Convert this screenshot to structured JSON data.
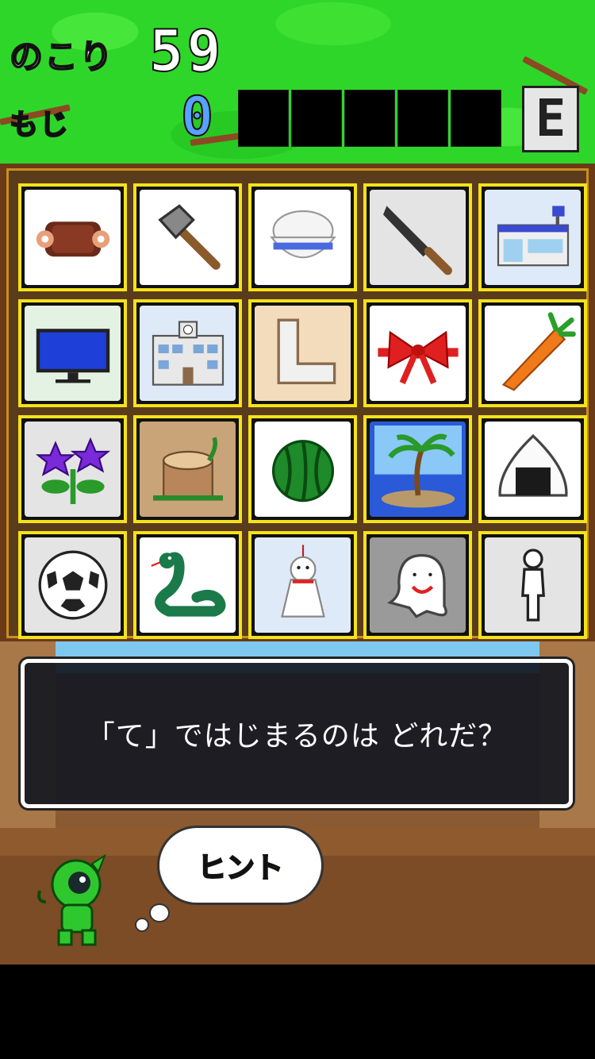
{
  "hud": {
    "remaining_label": "のこり",
    "remaining_value": "59",
    "letters_label": "もじ",
    "letters_value": "0",
    "grade": "E",
    "slot_count": 5
  },
  "board": {
    "cards": [
      {
        "icon": "meat-icon"
      },
      {
        "icon": "axe-icon"
      },
      {
        "icon": "rice-bowl-icon"
      },
      {
        "icon": "kitchen-knife-icon"
      },
      {
        "icon": "convenience-store-icon"
      },
      {
        "icon": "television-icon"
      },
      {
        "icon": "school-building-icon"
      },
      {
        "icon": "leg-icon"
      },
      {
        "icon": "ribbon-bow-icon"
      },
      {
        "icon": "carrot-icon"
      },
      {
        "icon": "bellflower-icon"
      },
      {
        "icon": "tree-stump-icon"
      },
      {
        "icon": "watermelon-icon"
      },
      {
        "icon": "palm-island-icon"
      },
      {
        "icon": "rice-ball-icon"
      },
      {
        "icon": "soccer-ball-icon"
      },
      {
        "icon": "snake-icon"
      },
      {
        "icon": "teru-teru-bozu-icon"
      },
      {
        "icon": "ghost-icon"
      },
      {
        "icon": "person-icon"
      }
    ]
  },
  "dialog": {
    "question": "「て」ではじまるのは どれだ？"
  },
  "hint": {
    "label": "ヒント"
  },
  "colors": {
    "hud_green": "#2fd62a",
    "card_border": "#f5e21a",
    "letters_blue": "#5aa0ff",
    "hint_yellow": "#f3d21a"
  }
}
